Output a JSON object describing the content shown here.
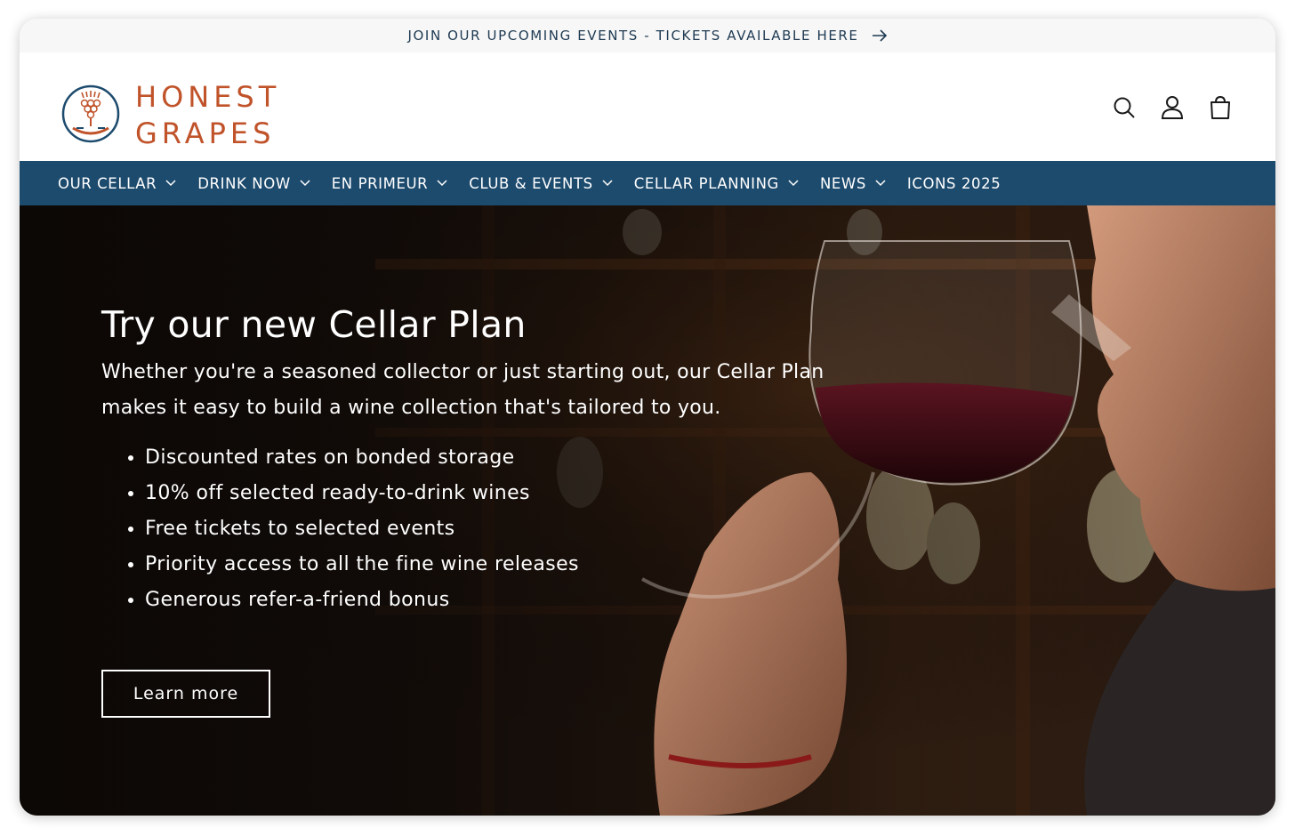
{
  "announcement": {
    "text": "JOIN OUR UPCOMING EVENTS - TICKETS AVAILABLE HERE",
    "icon": "arrow-right-icon"
  },
  "logo": {
    "line1": "HONEST",
    "line2": "GRAPES",
    "icon": "grape-emblem-icon",
    "color": "#c0532a"
  },
  "header_icons": [
    "search-icon",
    "account-icon",
    "cart-icon"
  ],
  "nav": {
    "items": [
      {
        "label": "OUR CELLAR",
        "has_dropdown": true
      },
      {
        "label": "DRINK NOW",
        "has_dropdown": true
      },
      {
        "label": "EN PRIMEUR",
        "has_dropdown": true
      },
      {
        "label": "CLUB & EVENTS",
        "has_dropdown": true
      },
      {
        "label": "CELLAR PLANNING",
        "has_dropdown": true
      },
      {
        "label": "NEWS",
        "has_dropdown": true
      },
      {
        "label": "ICONS 2025",
        "has_dropdown": false
      }
    ],
    "background": "#1d4b6e"
  },
  "hero": {
    "title": "Try our new Cellar Plan",
    "subtitle": "Whether you're a seasoned collector or just starting out, our Cellar Plan makes it easy to build a wine collection that's tailored to you.",
    "benefits": [
      "Discounted rates on bonded storage",
      "10% off selected ready-to-drink wines",
      "Free tickets to selected events",
      "Priority access to all the fine wine releases",
      "Generous refer-a-friend bonus"
    ],
    "cta_label": "Learn more"
  }
}
